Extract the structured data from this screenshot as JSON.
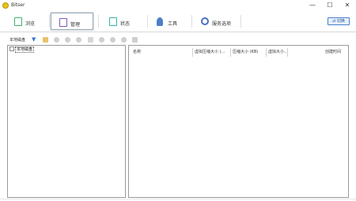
{
  "window": {
    "title": "Bitser",
    "minimize": "—",
    "maximize": "☐",
    "close": "✕"
  },
  "tabs": [
    {
      "label": "浏览",
      "color": "#3db36a"
    },
    {
      "label": "管理",
      "color": "#7a56c7"
    },
    {
      "label": "状态",
      "color": "#33b5a6"
    },
    {
      "label": "工具",
      "color": "#4a80c8"
    },
    {
      "label": "服务选项",
      "color": "#4a6fc8"
    }
  ],
  "switch_button": "⇄ 切换",
  "subtoolbar": {
    "dropdown_value": "本地磁盘",
    "dropdown_arrow": "▼",
    "icons": [
      "folder-icon",
      "circle-icon",
      "circle-icon",
      "circle-icon",
      "filter-icon",
      "circle-icon",
      "circle-icon",
      "circle-icon",
      "square-icon"
    ]
  },
  "tree": {
    "root_label": "本地磁盘"
  },
  "table": {
    "columns": [
      "名称",
      "虚拟压缩大小 (…",
      "压缩大小 (KB)",
      "虚拟大小…",
      "创建时间"
    ]
  }
}
